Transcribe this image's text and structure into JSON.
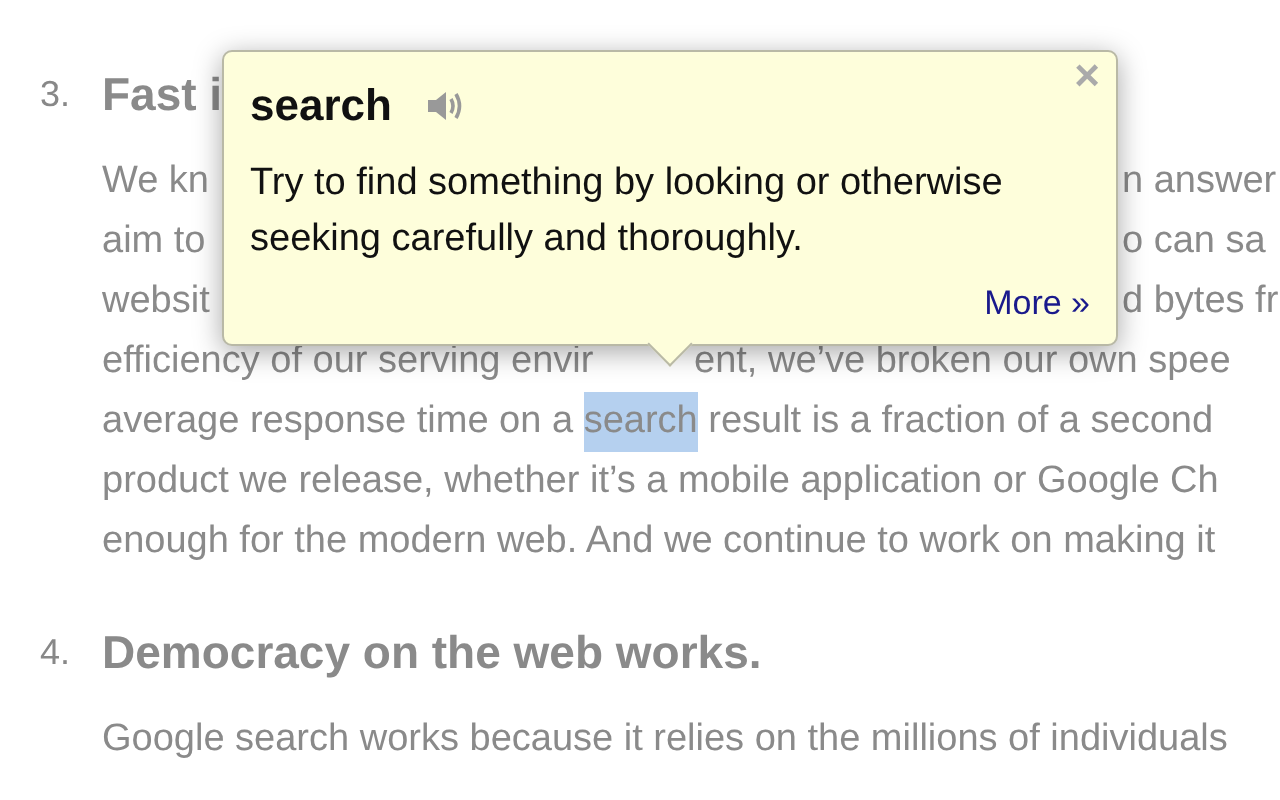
{
  "sections": [
    {
      "number": "3.",
      "heading": "Fast i",
      "lines": [
        {
          "kind": "covered",
          "left": "We kn",
          "right": "n answer"
        },
        {
          "kind": "covered",
          "left": "aim to",
          "right": "o can sa"
        },
        {
          "kind": "covered",
          "left": "websit",
          "right": "d bytes fr"
        },
        {
          "kind": "covered",
          "left": "efficiency of our serving envir",
          "right": "ent, we’ve broken our own spee"
        },
        {
          "kind": "plain",
          "runs": [
            {
              "text": "average response time on a ",
              "highlighted": false
            },
            {
              "text": "search",
              "highlighted": true
            },
            {
              "text": " result is a fraction of a second",
              "highlighted": false
            }
          ]
        },
        {
          "kind": "plain",
          "runs": [
            {
              "text": "product we release, whether it’s a mobile application or Google Ch",
              "highlighted": false
            }
          ]
        },
        {
          "kind": "plain",
          "runs": [
            {
              "text": "enough for the modern web. And we continue to work on making it",
              "highlighted": false
            }
          ]
        }
      ]
    },
    {
      "number": "4.",
      "heading": "Democracy on the web works.",
      "lines": [
        {
          "kind": "plain",
          "runs": [
            {
              "text": "Google search works because it relies on the millions of individuals",
              "highlighted": false
            }
          ]
        }
      ]
    }
  ],
  "popup": {
    "word": "search",
    "close": "×",
    "definition": "Try to find something by looking or otherwise seeking carefully and thoroughly.",
    "more_link": "More »"
  }
}
